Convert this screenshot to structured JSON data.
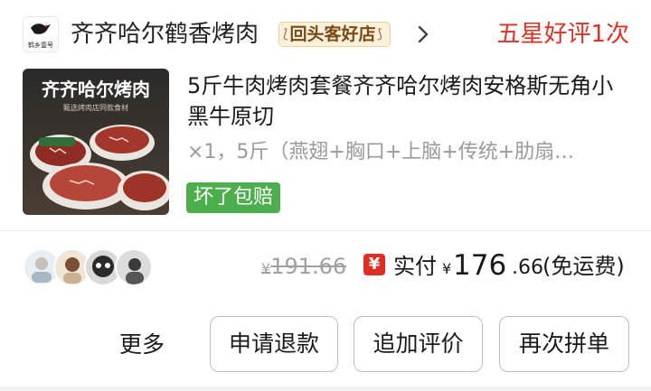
{
  "shop": {
    "logo_text": "鹤乡壹号",
    "name": "齐齐哈尔鹤香烤肉",
    "badge": "回头客好店",
    "review_status": "五星好评1次"
  },
  "product": {
    "image_overlay_title": "齐齐哈尔烤肉",
    "image_overlay_sub": "甄选烤肉店同款食材",
    "title": "5斤牛肉烤肉套餐齐齐哈尔烤肉安格斯无角小黑牛原切",
    "spec": "×1，5斤（燕翅+胸口+上脑+传统+肋扇…",
    "service_tag": "坏了包赔"
  },
  "price": {
    "original_currency": "¥",
    "original": "191.66",
    "pay_icon": "¥",
    "pay_label": "实付",
    "currency": "¥",
    "paid_integer": "176",
    "paid_decimal": ".66",
    "shipping_note": "(免运费)"
  },
  "actions": {
    "more": "更多",
    "refund": "申请退款",
    "add_review": "追加评价",
    "rebuy": "再次拼单"
  },
  "colors": {
    "accent_red": "#e02e24",
    "tag_green": "#4cae4c",
    "badge_gold": "#7a4a12"
  }
}
